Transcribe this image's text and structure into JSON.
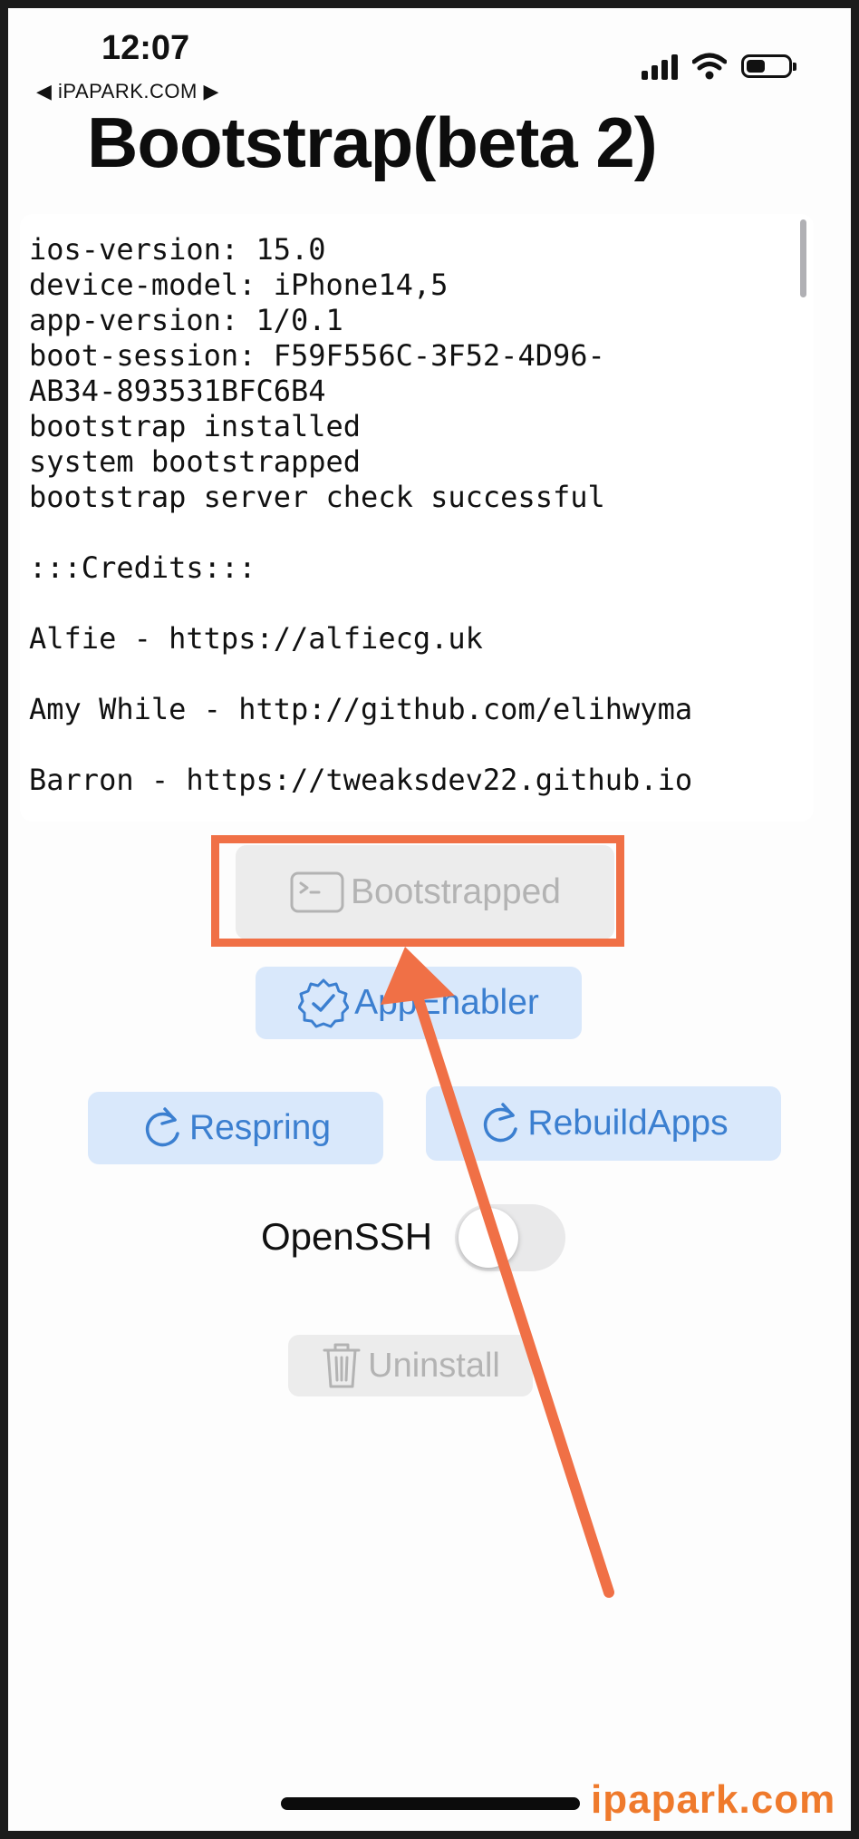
{
  "status_bar": {
    "time": "12:07",
    "back_label": "◀ iPAPARK.COM ▶"
  },
  "app": {
    "title": "Bootstrap(beta 2)"
  },
  "log": {
    "lines": [
      "ios-version: 15.0",
      "device-model: iPhone14,5",
      "app-version: 1/0.1",
      "boot-session: F59F556C-3F52-4D96-",
      "AB34-893531BFC6B4",
      "bootstrap installed",
      "system bootstrapped",
      "bootstrap server check successful",
      "",
      ":::Credits:::",
      "",
      "Alfie - https://alfiecg.uk",
      "",
      "Amy While - http://github.com/elihwyma",
      "",
      "Barron - https://tweaksdev22.github.io"
    ]
  },
  "buttons": {
    "bootstrap": "Bootstrapped",
    "app_enabler": "AppEnabler",
    "respring": "Respring",
    "rebuild_apps": "RebuildApps",
    "uninstall": "Uninstall"
  },
  "openssh": {
    "label": "OpenSSH",
    "enabled": false
  },
  "colors": {
    "accent": "#3b7fd0",
    "highlight": "#f07046",
    "watermark": "#ef7a2c"
  },
  "watermark": "ipapark.com"
}
